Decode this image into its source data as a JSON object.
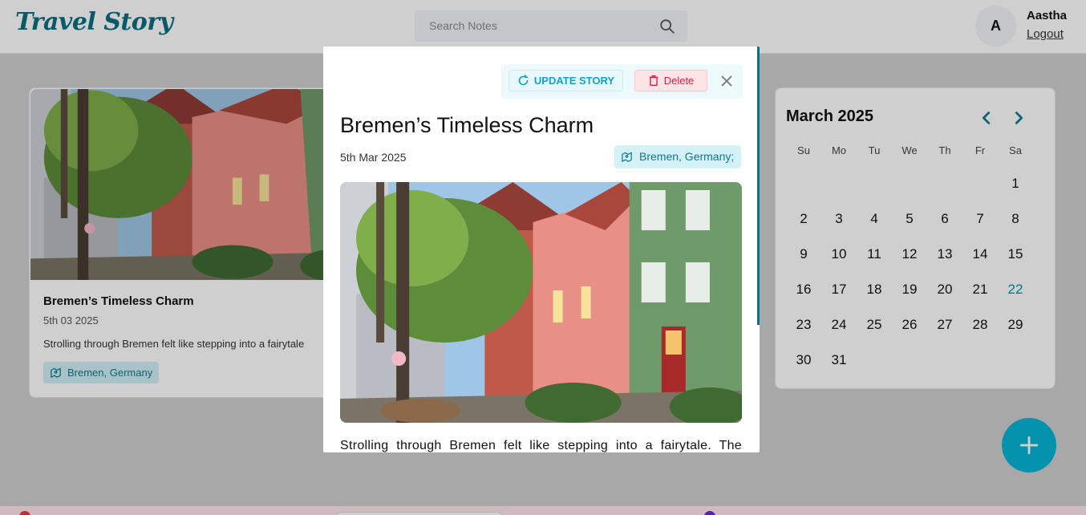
{
  "app": {
    "logo": "Travel Story"
  },
  "search": {
    "placeholder": "Search Notes"
  },
  "user": {
    "initial": "A",
    "name": "Aastha",
    "logout_label": "Logout"
  },
  "card": {
    "title": "Bremen’s Timeless Charm",
    "date": "5th 03 2025",
    "excerpt": "Strolling through Bremen felt like stepping into a fairytale",
    "location": "Bremen, Germany"
  },
  "calendar": {
    "month": "March 2025",
    "weekdays": [
      "Su",
      "Mo",
      "Tu",
      "We",
      "Th",
      "Fr",
      "Sa"
    ],
    "first_weekday_index": 6,
    "days_in_month": 31,
    "highlighted_day": 22
  },
  "modal": {
    "update_label": "UPDATE STORY",
    "delete_label": "Delete",
    "title": "Bremen’s Timeless Charm",
    "date": "5th Mar 2025",
    "location": "Bremen, Germany;",
    "story_text": "Strolling through Bremen felt like stepping into a fairytale. The"
  },
  "colors": {
    "brand": "#0a6f82",
    "accent": "#06b6d4",
    "delete": "#e11d48"
  },
  "icons": {
    "search": "search-icon",
    "location": "map-icon",
    "update": "refresh-icon",
    "delete": "trash-icon",
    "close": "close-icon",
    "add": "plus-icon"
  }
}
